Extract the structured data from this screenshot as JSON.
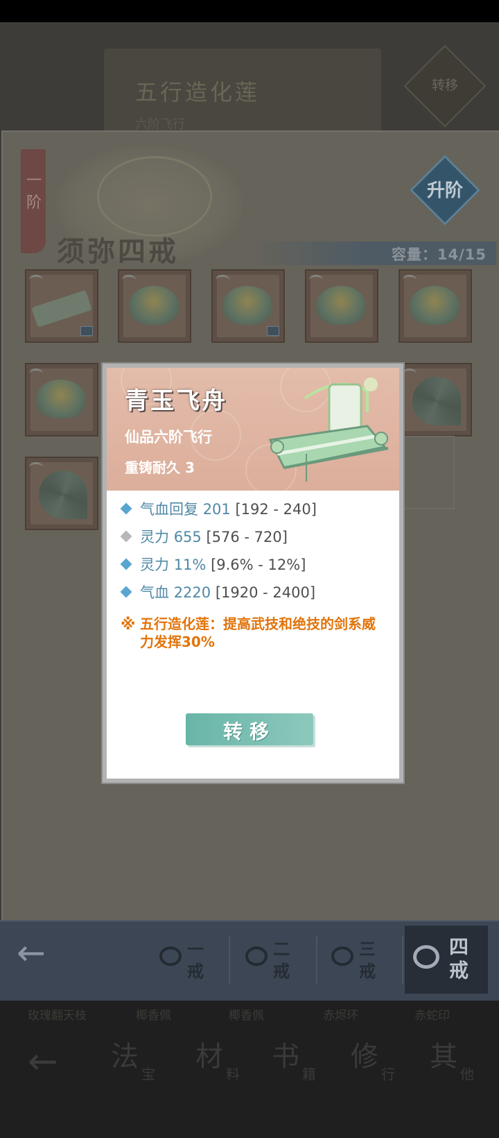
{
  "background_page": {
    "header_title": "五行造化莲",
    "header_subtitle": "六阶飞行",
    "transfer_button_label": "转移",
    "bottom_tabs": [
      {
        "main": "法",
        "sub": "宝"
      },
      {
        "main": "材",
        "sub": "料"
      },
      {
        "main": "书",
        "sub": "籍"
      },
      {
        "main": "修",
        "sub": "行"
      },
      {
        "main": "其",
        "sub": "他"
      }
    ],
    "item_names": [
      "玫瑰翻天枝",
      "椰香佩",
      "椰香佩",
      "赤烬环",
      "赤蛇印"
    ]
  },
  "ring_panel": {
    "tier_label": "一阶",
    "title": "须弥四戒",
    "upgrade_label": "升阶",
    "capacity_label": "容量：14/15",
    "slots_visible": 11
  },
  "ring_tabs": [
    {
      "label": "一戒",
      "active": false
    },
    {
      "label": "二戒",
      "active": false
    },
    {
      "label": "三戒",
      "active": false
    },
    {
      "label": "四戒",
      "active": true
    }
  ],
  "tooltip": {
    "item_name": "青玉飞舟",
    "item_tier": "仙品六阶飞行",
    "durability": "重铸耐久 3",
    "stats": [
      {
        "name": "气血回复",
        "value": "201",
        "range": "[192 - 240]",
        "marker_color": "#5aa5d0"
      },
      {
        "name": "灵力",
        "value": "655",
        "range": "[576 - 720]",
        "marker_color": "#b8b8b8"
      },
      {
        "name": "灵力",
        "value": "11%",
        "range": "[9.6% - 12%]",
        "marker_color": "#5aa5d0"
      },
      {
        "name": "气血",
        "value": "2220",
        "range": "[1920 - 2400]",
        "marker_color": "#5aa5d0"
      }
    ],
    "set_effect": "五行造化莲：提高武技和绝技的剑系威力发挥30%",
    "set_icon": "※",
    "transfer_button": "转移"
  },
  "colors": {
    "stat_blue": "#4f88a5",
    "set_orange": "#e2740c",
    "button_teal": "#68b5a8"
  }
}
